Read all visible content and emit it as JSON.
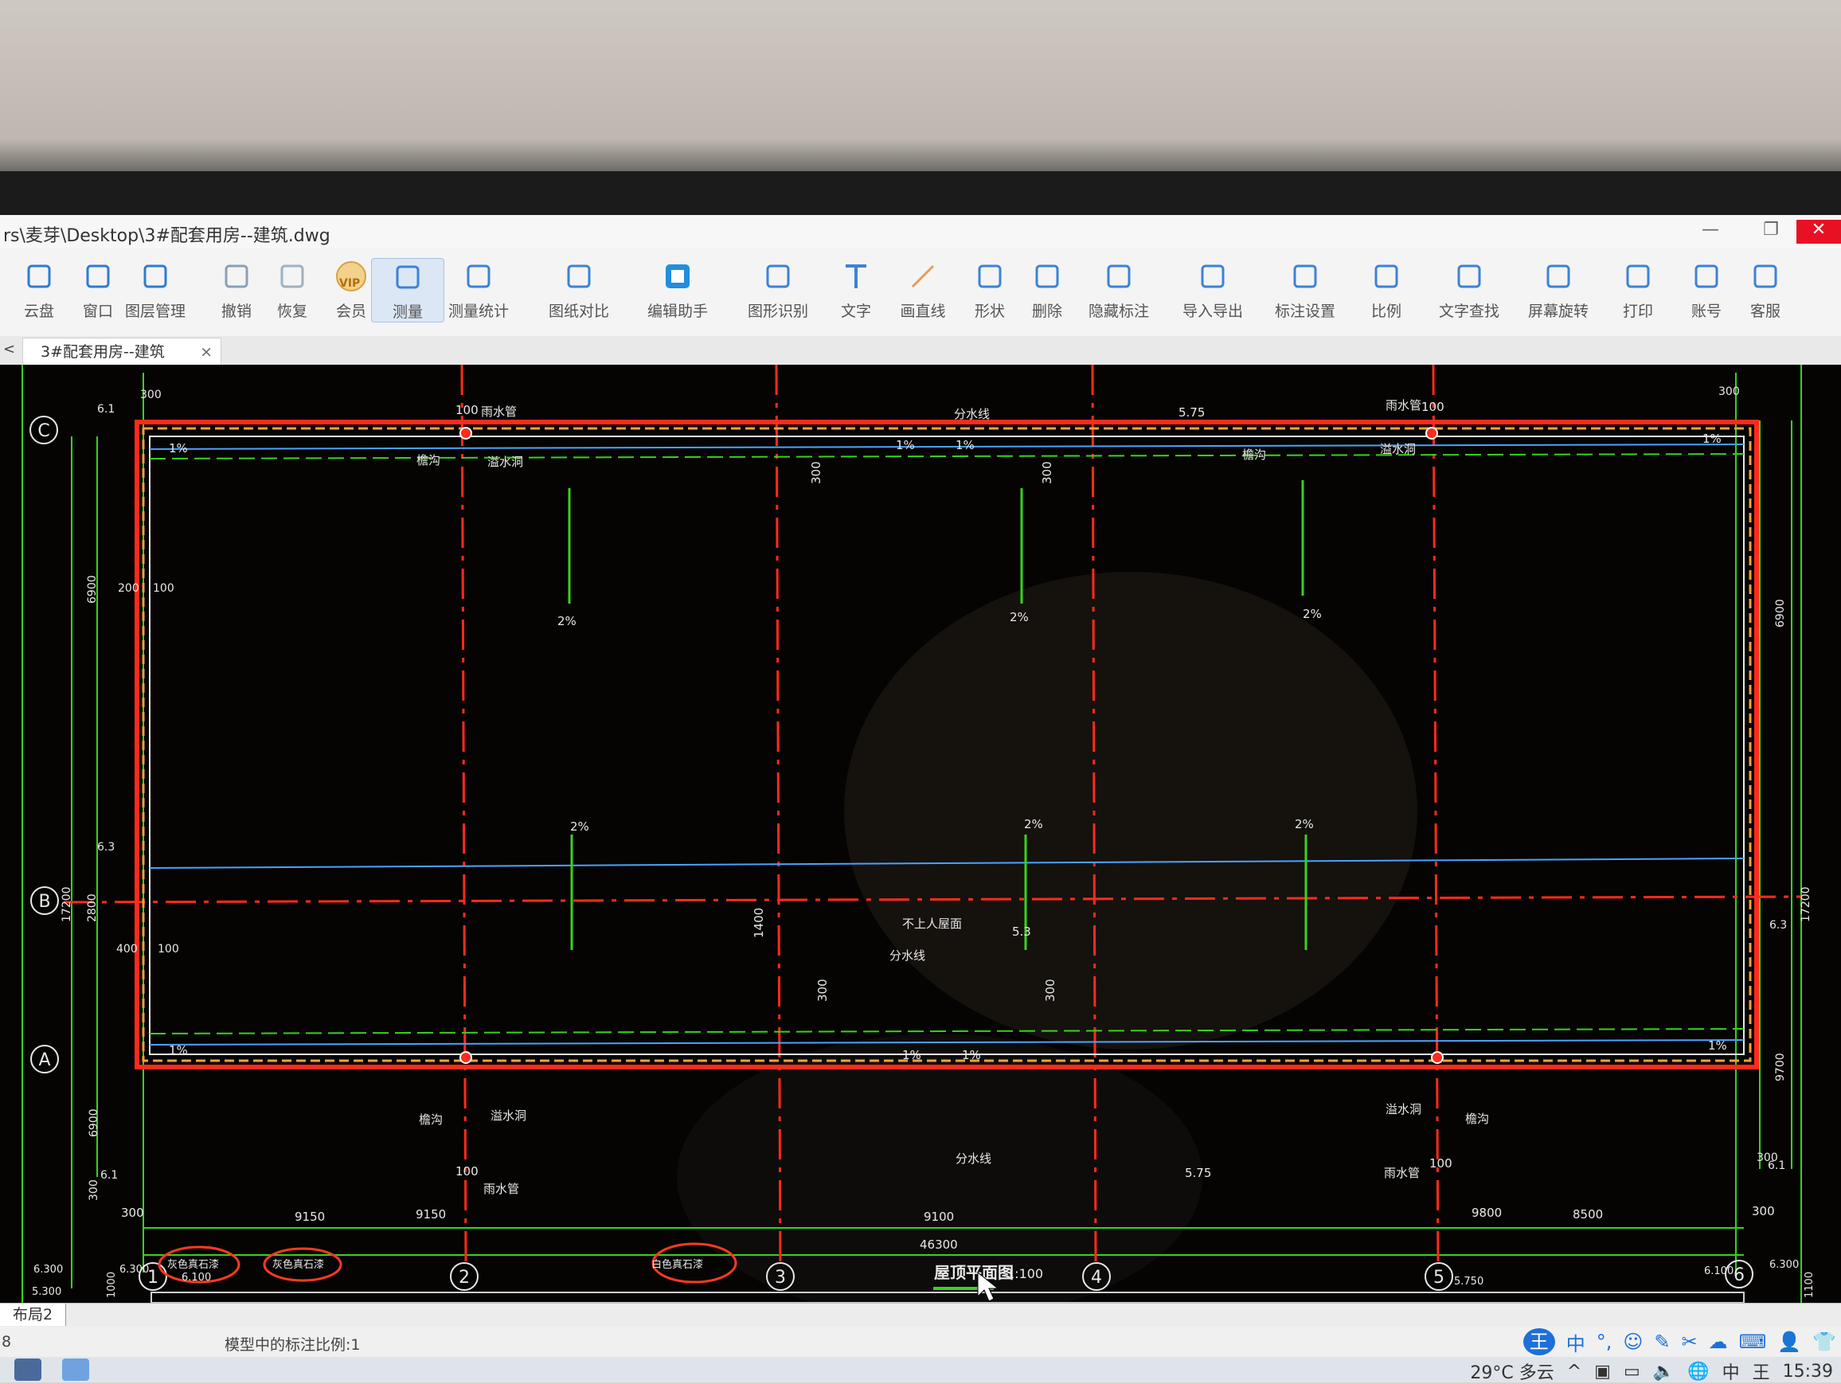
{
  "window": {
    "title": "rs\\麦芽\\Desktop\\3#配套用房--建筑.dwg",
    "minimize": "—",
    "maximize": "❐",
    "close": "✕"
  },
  "toolbar": {
    "items": [
      {
        "label": "云盘",
        "icon": "cloud-icon"
      },
      {
        "label": "窗口",
        "icon": "window-icon"
      },
      {
        "label": "图层管理",
        "icon": "layers-icon"
      },
      {
        "label": "撤销",
        "icon": "undo-icon"
      },
      {
        "label": "恢复",
        "icon": "redo-icon"
      },
      {
        "label": "会员",
        "icon": "vip-icon"
      },
      {
        "label": "测量",
        "icon": "measure-icon"
      },
      {
        "label": "测量统计",
        "icon": "measure-stats-icon"
      },
      {
        "label": "图纸对比",
        "icon": "compare-icon"
      },
      {
        "label": "编辑助手",
        "icon": "edit-assistant-icon"
      },
      {
        "label": "图形识别",
        "icon": "shape-recognize-icon"
      },
      {
        "label": "文字",
        "icon": "text-icon"
      },
      {
        "label": "画直线",
        "icon": "line-icon"
      },
      {
        "label": "形状",
        "icon": "shape-icon"
      },
      {
        "label": "删除",
        "icon": "eraser-icon"
      },
      {
        "label": "隐藏标注",
        "icon": "hide-annotation-icon"
      },
      {
        "label": "导入导出",
        "icon": "import-export-icon"
      },
      {
        "label": "标注设置",
        "icon": "annotation-settings-icon"
      },
      {
        "label": "比例",
        "icon": "scale-icon"
      },
      {
        "label": "文字查找",
        "icon": "text-search-icon"
      },
      {
        "label": "屏幕旋转",
        "icon": "screen-rotate-icon"
      },
      {
        "label": "打印",
        "icon": "print-icon"
      },
      {
        "label": "账号",
        "icon": "account-icon"
      },
      {
        "label": "客服",
        "icon": "headset-icon"
      }
    ],
    "vip_text": "VIP"
  },
  "tabs": {
    "arrow": "<",
    "active_label": "3#配套用房--建筑",
    "close": "×"
  },
  "drawing": {
    "axis_rows": [
      "C",
      "B",
      "A"
    ],
    "axis_cols": [
      "1",
      "2",
      "3",
      "4",
      "5",
      "6"
    ],
    "dims_bottom": [
      "300",
      "9150",
      "9150",
      "9100",
      "9800",
      "8500",
      "300",
      "46300"
    ],
    "dims_left": [
      "300",
      "6.1",
      "6900",
      "17200",
      "2800",
      "6.3",
      "6900",
      "300",
      "6.1",
      "200",
      "100",
      "400",
      "100"
    ],
    "dims_right": [
      "300",
      "6900",
      "17200",
      "6.3",
      "9700",
      "6.3",
      "300",
      "6.1"
    ],
    "notes": {
      "roof": "不上人屋面",
      "elev_center": "5.3",
      "ridge_top": "分水线",
      "ridge_mid": "分水线",
      "ridge_bottom": "分水线",
      "elev_top": "5.75",
      "elev_bottom": "5.75",
      "drain_cn": "雨水管",
      "gutter": "檐沟",
      "overflow": "溢水洞",
      "slope_1": "1%",
      "slope_2": "2%",
      "dim_300": "300",
      "dim_100": "100",
      "dim_1400": "1400"
    },
    "plan_title": "屋顶平面图",
    "plan_scale": "1:100",
    "section": {
      "label_1": "灰色真石漆",
      "label_2": "灰色真石漆",
      "label_3": "白色真石漆",
      "elev_6300_l": "6.300",
      "elev_6300_l2": "6.300",
      "elev_6100_l": "6.100",
      "elev_5300": "5.300",
      "elev_5750": "5.750",
      "elev_6100_r": "6.100",
      "elev_6300_r": "6.300",
      "dim_1000": "1000",
      "dim_1100": "1100"
    }
  },
  "layout_tab": "布局2",
  "status": {
    "left": "8",
    "scale_text": "模型中的标注比例:1"
  },
  "ime": {
    "badge": "王",
    "items": [
      "中",
      "°,",
      "☺",
      "✎",
      "✂",
      "☁",
      "⌨",
      "👤",
      "👕"
    ]
  },
  "taskbar": {
    "weather": "29°C 多云",
    "tray_items": [
      "^",
      "▣",
      "▭",
      "🔈",
      "🌐",
      "中",
      "王"
    ],
    "time": "15:39"
  },
  "colors": {
    "canvas": "#050403",
    "axis_red": "#ff2b1c",
    "dim_green": "#39d21a",
    "wall_white": "#e8e8e8",
    "blue_line": "#4aa3ff",
    "brand_blue": "#1e6fd9"
  }
}
